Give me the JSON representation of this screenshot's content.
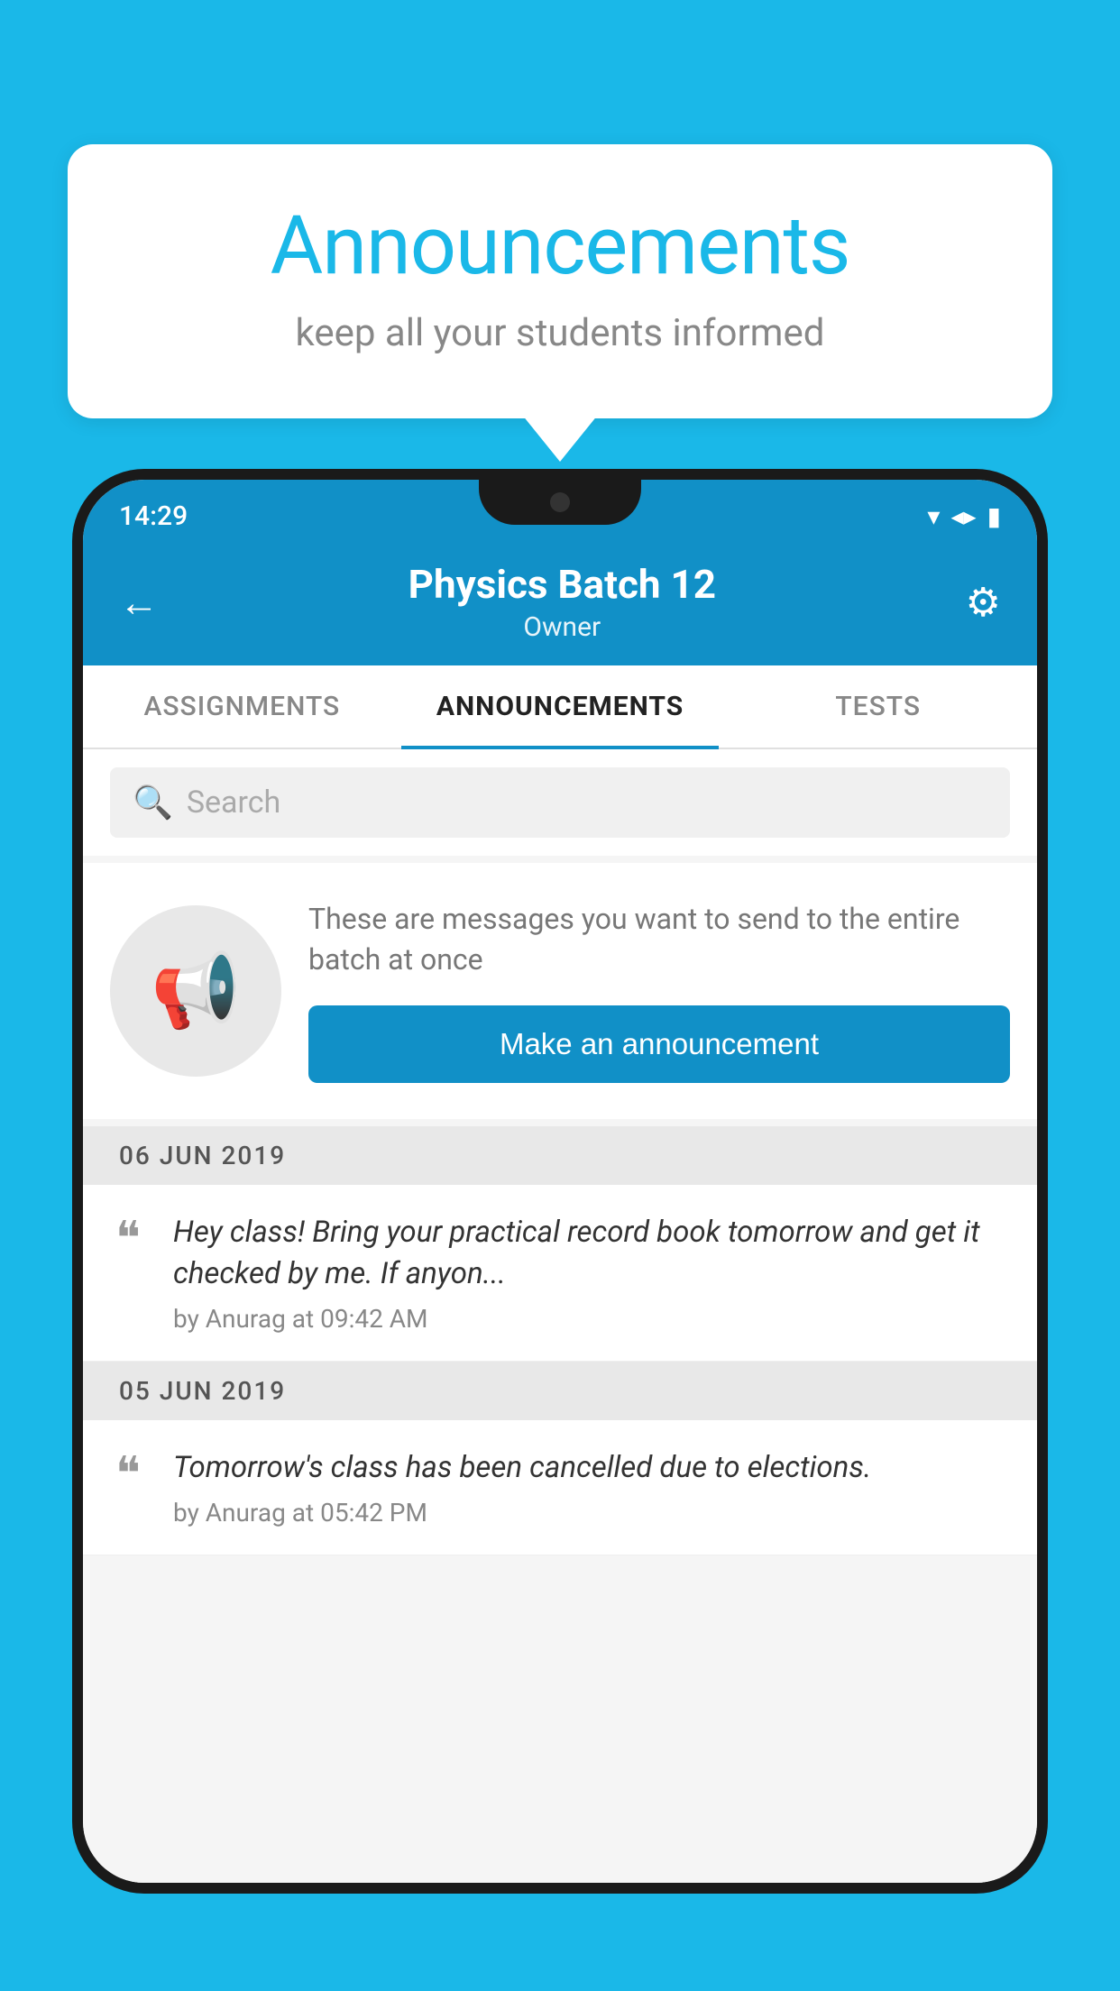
{
  "background_color": "#1ab8e8",
  "speech_bubble": {
    "title": "Announcements",
    "subtitle": "keep all your students informed"
  },
  "status_bar": {
    "time": "14:29",
    "wifi": "▼",
    "signal": "▲",
    "battery": "▐"
  },
  "header": {
    "back_label": "←",
    "title": "Physics Batch 12",
    "subtitle": "Owner",
    "gear_label": "⚙"
  },
  "tabs": [
    {
      "label": "ASSIGNMENTS",
      "active": false
    },
    {
      "label": "ANNOUNCEMENTS",
      "active": true
    },
    {
      "label": "TESTS",
      "active": false
    }
  ],
  "search": {
    "placeholder": "Search"
  },
  "promo": {
    "description": "These are messages you want to send to the entire batch at once",
    "button_label": "Make an announcement"
  },
  "announcements": [
    {
      "date": "06  JUN  2019",
      "text": "Hey class! Bring your practical record book tomorrow and get it checked by me. If anyon...",
      "meta": "by Anurag at 09:42 AM"
    },
    {
      "date": "05  JUN  2019",
      "text": "Tomorrow's class has been cancelled due to elections.",
      "meta": "by Anurag at 05:42 PM"
    }
  ]
}
